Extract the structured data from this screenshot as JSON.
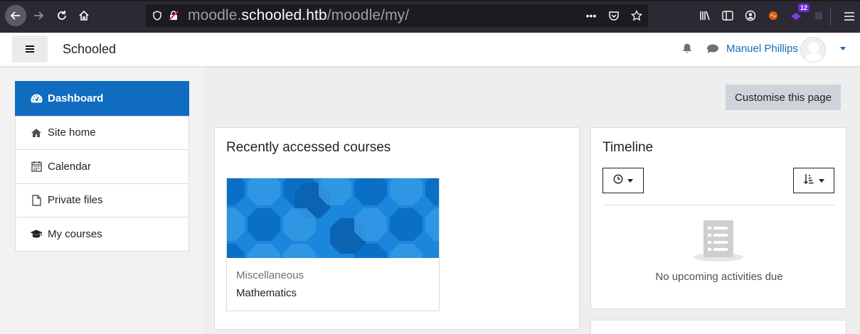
{
  "browser": {
    "url_prefix": "moodle.",
    "url_host": "schooled.htb",
    "url_path": "/moodle/my/",
    "extension_badge": "12",
    "icons": [
      "back-icon",
      "forward-icon",
      "reload-icon",
      "home-icon",
      "shield-icon",
      "insecure-lock-icon",
      "more-icon",
      "pocket-icon",
      "bookmark-star-icon",
      "library-icon",
      "sidebar-icon",
      "account-icon",
      "extension-icon",
      "menu-icon"
    ]
  },
  "navbar": {
    "site_name": "Schooled",
    "user_name": "Manuel Phillips"
  },
  "drawer": {
    "items": [
      {
        "label": "Dashboard",
        "icon": "dashboard-icon",
        "active": true
      },
      {
        "label": "Site home",
        "icon": "home-icon",
        "active": false
      },
      {
        "label": "Calendar",
        "icon": "calendar-icon",
        "active": false
      },
      {
        "label": "Private files",
        "icon": "file-icon",
        "active": false
      },
      {
        "label": "My courses",
        "icon": "graduation-cap-icon",
        "active": false
      }
    ]
  },
  "main": {
    "customise_label": "Customise this page",
    "recent": {
      "title": "Recently accessed courses",
      "courses": [
        {
          "category": "Miscellaneous",
          "name": "Mathematics"
        }
      ]
    },
    "timeline": {
      "title": "Timeline",
      "empty_text": "No upcoming activities due"
    }
  },
  "colors": {
    "accent": "#0f6cbf",
    "browser_bg": "#2b2a33",
    "button_grey": "#ced4da"
  }
}
